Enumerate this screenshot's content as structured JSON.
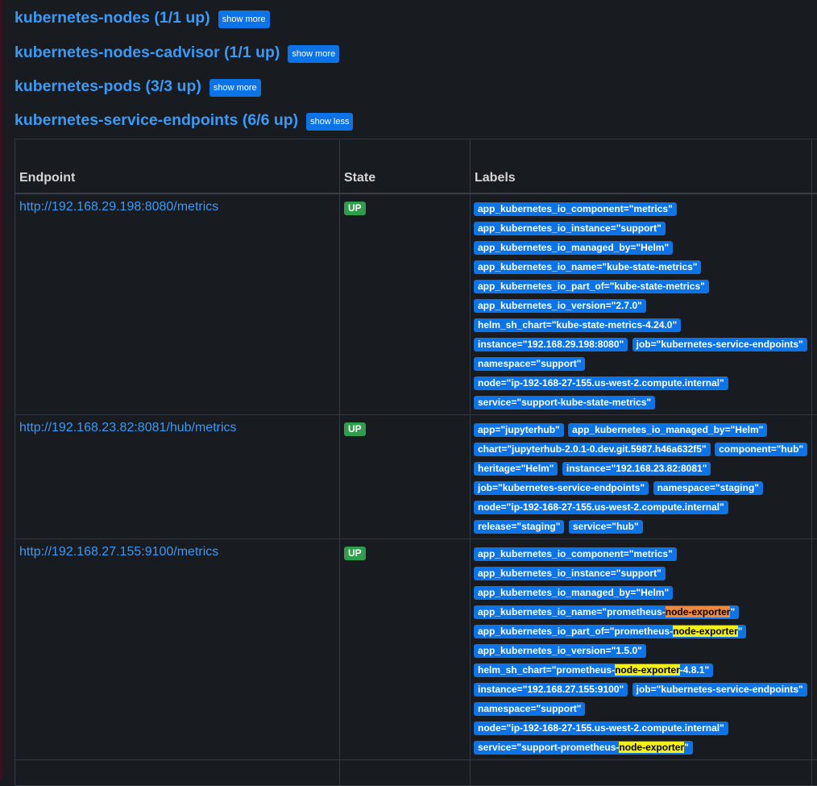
{
  "jobs": [
    {
      "title": "kubernetes-nodes (1/1 up)",
      "button": "show more"
    },
    {
      "title": "kubernetes-nodes-cadvisor (1/1 up)",
      "button": "show more"
    },
    {
      "title": "kubernetes-pods (3/3 up)",
      "button": "show more"
    },
    {
      "title": "kubernetes-service-endpoints (6/6 up)",
      "button": "show less"
    }
  ],
  "table": {
    "headers": {
      "endpoint": "Endpoint",
      "state": "State",
      "labels": "Labels"
    },
    "rows": [
      {
        "endpoint": "http://192.168.29.198:8080/metrics",
        "state": "UP",
        "labels": [
          "app_kubernetes_io_component=\"metrics\"",
          "app_kubernetes_io_instance=\"support\"",
          "app_kubernetes_io_managed_by=\"Helm\"",
          "app_kubernetes_io_name=\"kube-state-metrics\"",
          "app_kubernetes_io_part_of=\"kube-state-metrics\"",
          "app_kubernetes_io_version=\"2.7.0\"",
          "helm_sh_chart=\"kube-state-metrics-4.24.0\"",
          "instance=\"192.168.29.198:8080\"",
          "job=\"kubernetes-service-endpoints\"",
          "namespace=\"support\"",
          "node=\"ip-192-168-27-155.us-west-2.compute.internal\"",
          "service=\"support-kube-state-metrics\""
        ]
      },
      {
        "endpoint": "http://192.168.23.82:8081/hub/metrics",
        "state": "UP",
        "labels": [
          "app=\"jupyterhub\"",
          "app_kubernetes_io_managed_by=\"Helm\"",
          "chart=\"jupyterhub-2.0.1-0.dev.git.5987.h46a632f5\"",
          "component=\"hub\"",
          "heritage=\"Helm\"",
          "instance=\"192.168.23.82:8081\"",
          "job=\"kubernetes-service-endpoints\"",
          "namespace=\"staging\"",
          "node=\"ip-192-168-27-155.us-west-2.compute.internal\"",
          "release=\"staging\"",
          "service=\"hub\""
        ]
      },
      {
        "endpoint": "http://192.168.27.155:9100/metrics",
        "state": "UP",
        "labels": [
          "app_kubernetes_io_component=\"metrics\"",
          "app_kubernetes_io_instance=\"support\"",
          "app_kubernetes_io_managed_by=\"Helm\"",
          "app_kubernetes_io_name=\"prometheus-node-exporter\"",
          "app_kubernetes_io_part_of=\"prometheus-node-exporter\"",
          "app_kubernetes_io_version=\"1.5.0\"",
          "helm_sh_chart=\"prometheus-node-exporter-4.8.1\"",
          "instance=\"192.168.27.155:9100\"",
          "job=\"kubernetes-service-endpoints\"",
          "namespace=\"support\"",
          "node=\"ip-192-168-27-155.us-west-2.compute.internal\"",
          "service=\"support-prometheus-node-exporter\""
        ]
      }
    ]
  },
  "search": {
    "highlight_term": "node-exporter",
    "active_match_label": "app_kubernetes_io_name=\"prometheus-node-exporter\""
  },
  "colors": {
    "background": "#181b1f",
    "link": "#3b9af5",
    "button": "#0d74e8",
    "up_badge": "#2e9d4c",
    "highlight": "#f4ef19",
    "active_highlight": "#ef8a3c"
  }
}
